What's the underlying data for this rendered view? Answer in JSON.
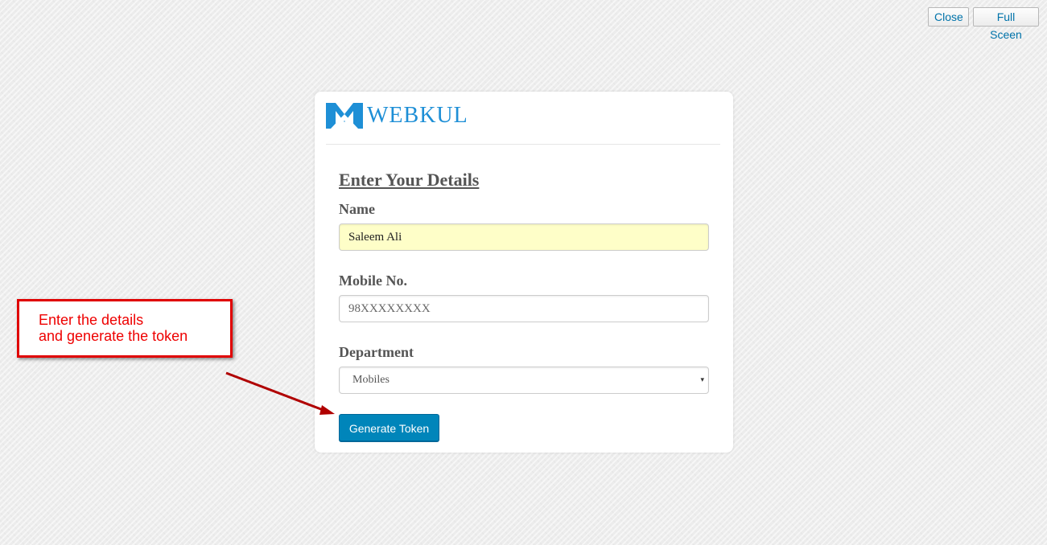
{
  "window": {
    "close_label": "Close",
    "fullscreen_label": "Full Sceen"
  },
  "brand": {
    "logo_text": "WEBKUL",
    "color": "#1e8fd6"
  },
  "form": {
    "title": "Enter Your Details",
    "name": {
      "label": "Name",
      "value": "Saleem Ali"
    },
    "mobile": {
      "label": "Mobile No.",
      "placeholder": "98XXXXXXXX"
    },
    "department": {
      "label": "Department",
      "selected": "Mobiles",
      "arrow_icon": "▾"
    },
    "submit_label": "Generate Token",
    "submit_color": "#0085ba"
  },
  "annotation": {
    "line1": "Enter the details",
    "line2": "and generate the token",
    "color": "#e00000"
  }
}
